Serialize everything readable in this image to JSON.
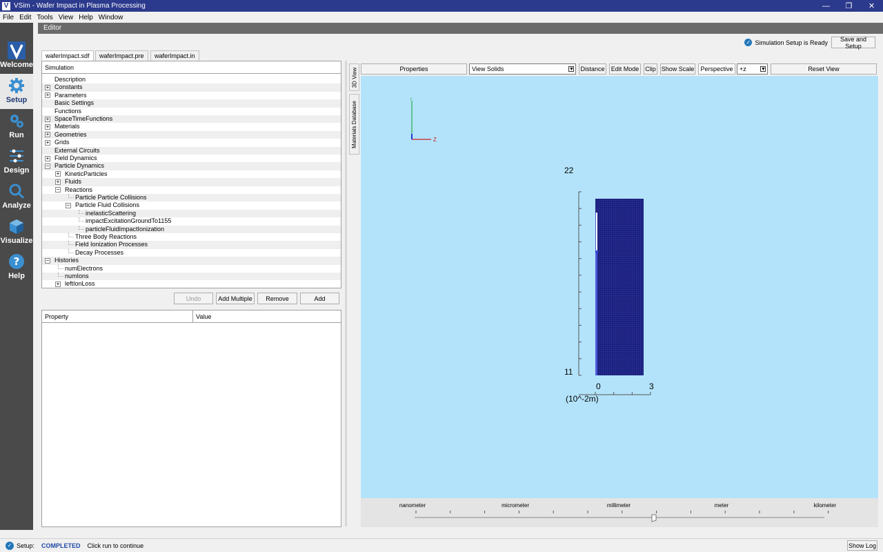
{
  "window": {
    "title": "VSim - Wafer Impact in Plasma Processing",
    "app_icon": "V",
    "minimize": "—",
    "maximize": "❐",
    "close": "✕"
  },
  "menubar": [
    "File",
    "Edit",
    "Tools",
    "View",
    "Help",
    "Window"
  ],
  "sidebar": [
    {
      "label": "Welcome",
      "icon": "vsim-logo-icon"
    },
    {
      "label": "Setup",
      "icon": "gear-icon"
    },
    {
      "label": "Run",
      "icon": "gears-icon"
    },
    {
      "label": "Design",
      "icon": "sliders-icon"
    },
    {
      "label": "Analyze",
      "icon": "magnifier-icon"
    },
    {
      "label": "Visualize",
      "icon": "cube-icon"
    },
    {
      "label": "Help",
      "icon": "question-icon"
    }
  ],
  "editor": {
    "header": "Editor",
    "status_ready": "Simulation Setup is Ready",
    "save_setup": "Save and Setup",
    "file_tabs": [
      "waferImpact.sdf",
      "waferImpact.pre",
      "waferImpact.in"
    ]
  },
  "tree": {
    "header": "Simulation",
    "rows": [
      {
        "label": "Description",
        "indent": 0,
        "exp": ""
      },
      {
        "label": "Constants",
        "indent": 0,
        "exp": "+"
      },
      {
        "label": "Parameters",
        "indent": 0,
        "exp": "+"
      },
      {
        "label": "Basic Settings",
        "indent": 0,
        "exp": ""
      },
      {
        "label": "Functions",
        "indent": 0,
        "exp": ""
      },
      {
        "label": "SpaceTimeFunctions",
        "indent": 0,
        "exp": "+"
      },
      {
        "label": "Materials",
        "indent": 0,
        "exp": "+"
      },
      {
        "label": "Geometries",
        "indent": 0,
        "exp": "+"
      },
      {
        "label": "Grids",
        "indent": 0,
        "exp": "+"
      },
      {
        "label": "External Circuits",
        "indent": 0,
        "exp": ""
      },
      {
        "label": "Field Dynamics",
        "indent": 0,
        "exp": "+"
      },
      {
        "label": "Particle Dynamics",
        "indent": 0,
        "exp": "−"
      },
      {
        "label": "KineticParticles",
        "indent": 1,
        "exp": "+"
      },
      {
        "label": "Fluids",
        "indent": 1,
        "exp": "+"
      },
      {
        "label": "Reactions",
        "indent": 1,
        "exp": "−"
      },
      {
        "label": "Particle Particle Collisions",
        "indent": 2,
        "exp": ""
      },
      {
        "label": "Particle Fluid Collisions",
        "indent": 2,
        "exp": "−"
      },
      {
        "label": "inelasticScattering",
        "indent": 3,
        "exp": ""
      },
      {
        "label": "impactExcitationGroundTo1155",
        "indent": 3,
        "exp": ""
      },
      {
        "label": "particleFluidImpactIonization",
        "indent": 3,
        "exp": ""
      },
      {
        "label": "Three Body Reactions",
        "indent": 2,
        "exp": ""
      },
      {
        "label": "Field Ionization Processes",
        "indent": 2,
        "exp": ""
      },
      {
        "label": "Decay Processes",
        "indent": 2,
        "exp": ""
      },
      {
        "label": "Histories",
        "indent": 0,
        "exp": "−"
      },
      {
        "label": "numElectrons",
        "indent": 1,
        "exp": ""
      },
      {
        "label": "numIons",
        "indent": 1,
        "exp": ""
      },
      {
        "label": "leftIonLoss",
        "indent": 1,
        "exp": "+"
      }
    ]
  },
  "tree_buttons": {
    "undo": "Undo",
    "add_multiple": "Add Multiple",
    "remove": "Remove",
    "add": "Add"
  },
  "property_table": {
    "col1": "Property",
    "col2": "Value"
  },
  "vertical_tabs": {
    "view3d": "3D View",
    "materials": "Materials Database"
  },
  "viewer": {
    "properties": "Properties",
    "view_mode": "View Solids",
    "distance": "Distance",
    "edit_mode": "Edit Mode",
    "clip": "Clip",
    "show_scale": "Show Scale",
    "perspective": "Perspective",
    "axis": "+z",
    "reset_view": "Reset View"
  },
  "axes_triad": {
    "up": "r",
    "right": "Z"
  },
  "plot": {
    "y_top": "22",
    "y_bottom": "11",
    "x_left": "0",
    "x_right": "3",
    "unit": "(10^-2m)"
  },
  "scale_labels": [
    "nanometer",
    "micrometer",
    "millimeter",
    "meter",
    "kilometer"
  ],
  "statusbar": {
    "label": "Setup:",
    "state": "COMPLETED",
    "hint": "Click run to continue",
    "show_log": "Show Log"
  }
}
